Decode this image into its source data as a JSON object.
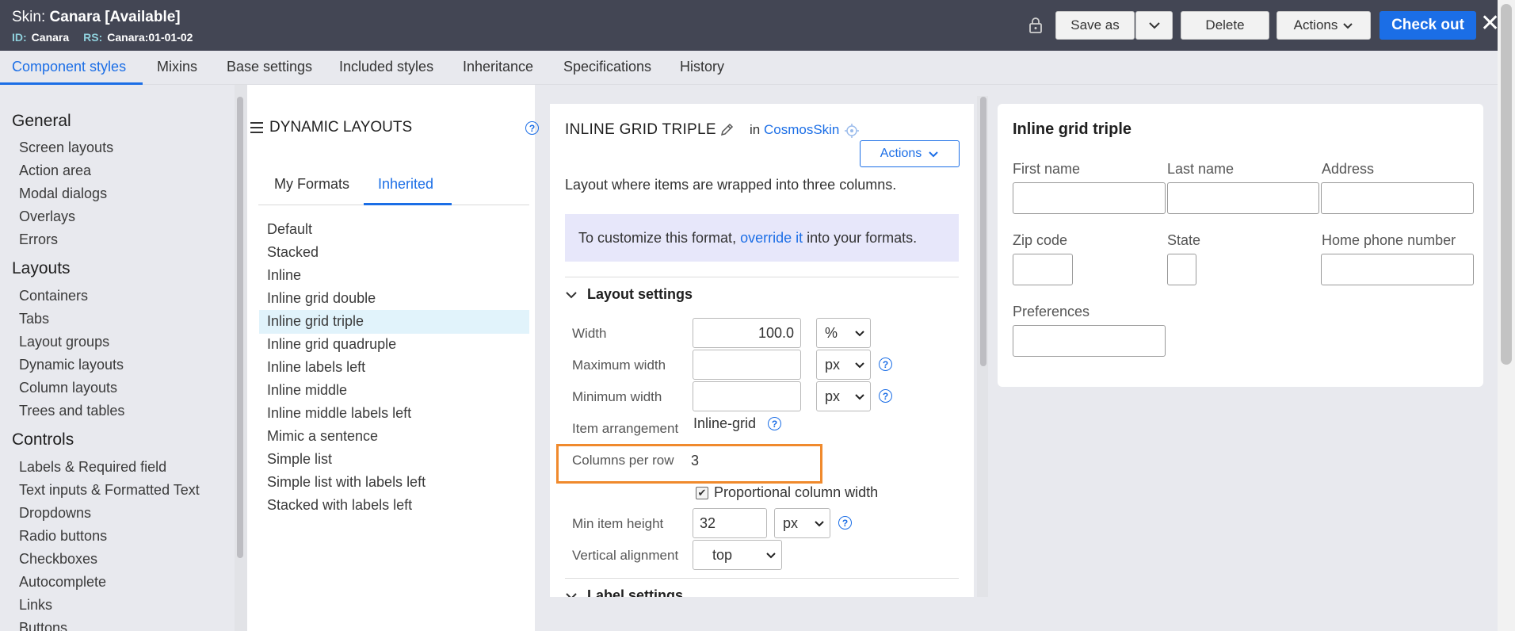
{
  "header": {
    "skin_prefix": "Skin: ",
    "skin_name": "Canara [Available]",
    "id_key": "ID:",
    "id_value": "Canara",
    "rs_key": "RS:",
    "rs_value": "Canara:01-01-02",
    "save_as": "Save as",
    "delete": "Delete",
    "actions": "Actions",
    "check_out": "Check out"
  },
  "tabs": [
    "Component styles",
    "Mixins",
    "Base settings",
    "Included styles",
    "Inheritance",
    "Specifications",
    "History"
  ],
  "leftnav": {
    "general_title": "General",
    "general": [
      "Screen layouts",
      "Action area",
      "Modal dialogs",
      "Overlays",
      "Errors"
    ],
    "layouts_title": "Layouts",
    "layouts": [
      "Containers",
      "Tabs",
      "Layout groups",
      "Dynamic layouts",
      "Column layouts",
      "Trees and tables"
    ],
    "controls_title": "Controls",
    "controls": [
      "Labels & Required field",
      "Text inputs & Formatted Text",
      "Dropdowns",
      "Radio buttons",
      "Checkboxes",
      "Autocomplete",
      "Links",
      "Buttons"
    ]
  },
  "formats_panel": {
    "title": "DYNAMIC LAYOUTS",
    "tab_my": "My Formats",
    "tab_inherited": "Inherited",
    "items": [
      "Default",
      "Stacked",
      "Inline",
      "Inline grid double",
      "Inline grid triple",
      "Inline grid quadruple",
      "Inline labels left",
      "Inline middle",
      "Inline middle labels left",
      "Mimic a sentence",
      "Simple list",
      "Simple list with labels left",
      "Stacked with labels left"
    ],
    "selected": "Inline grid triple"
  },
  "editor": {
    "title": "INLINE GRID TRIPLE",
    "in_text": "in",
    "skin_link": "CosmosSkin",
    "actions": "Actions",
    "description": "Layout where items are wrapped into three columns.",
    "info_prefix": "To customize this format, ",
    "info_link": "override it",
    "info_suffix": " into your formats.",
    "section_layout": "Layout settings",
    "width_label": "Width",
    "width_value": "100.0",
    "width_unit": "%",
    "max_width_label": "Maximum width",
    "max_width_value": "",
    "max_width_unit": "px",
    "min_width_label": "Minimum width",
    "min_width_value": "",
    "min_width_unit": "px",
    "arrangement_label": "Item arrangement",
    "arrangement_value": "Inline-grid",
    "columns_label": "Columns per row",
    "columns_value": "3",
    "proportional_label": "Proportional column width",
    "proportional_checked": true,
    "min_height_label": "Min item height",
    "min_height_value": "32",
    "min_height_unit": "px",
    "valign_label": "Vertical alignment",
    "valign_value": "top",
    "section_label": "Label settings"
  },
  "preview": {
    "title": "Inline grid triple",
    "fields": [
      "First name",
      "Last name",
      "Address",
      "Zip code",
      "State",
      "Home phone number",
      "Preferences"
    ]
  },
  "colors": {
    "accent": "#1b6ee6",
    "header_bg": "#434654",
    "highlight_border": "#f08a2d",
    "selected_row": "#e1f3fb"
  }
}
